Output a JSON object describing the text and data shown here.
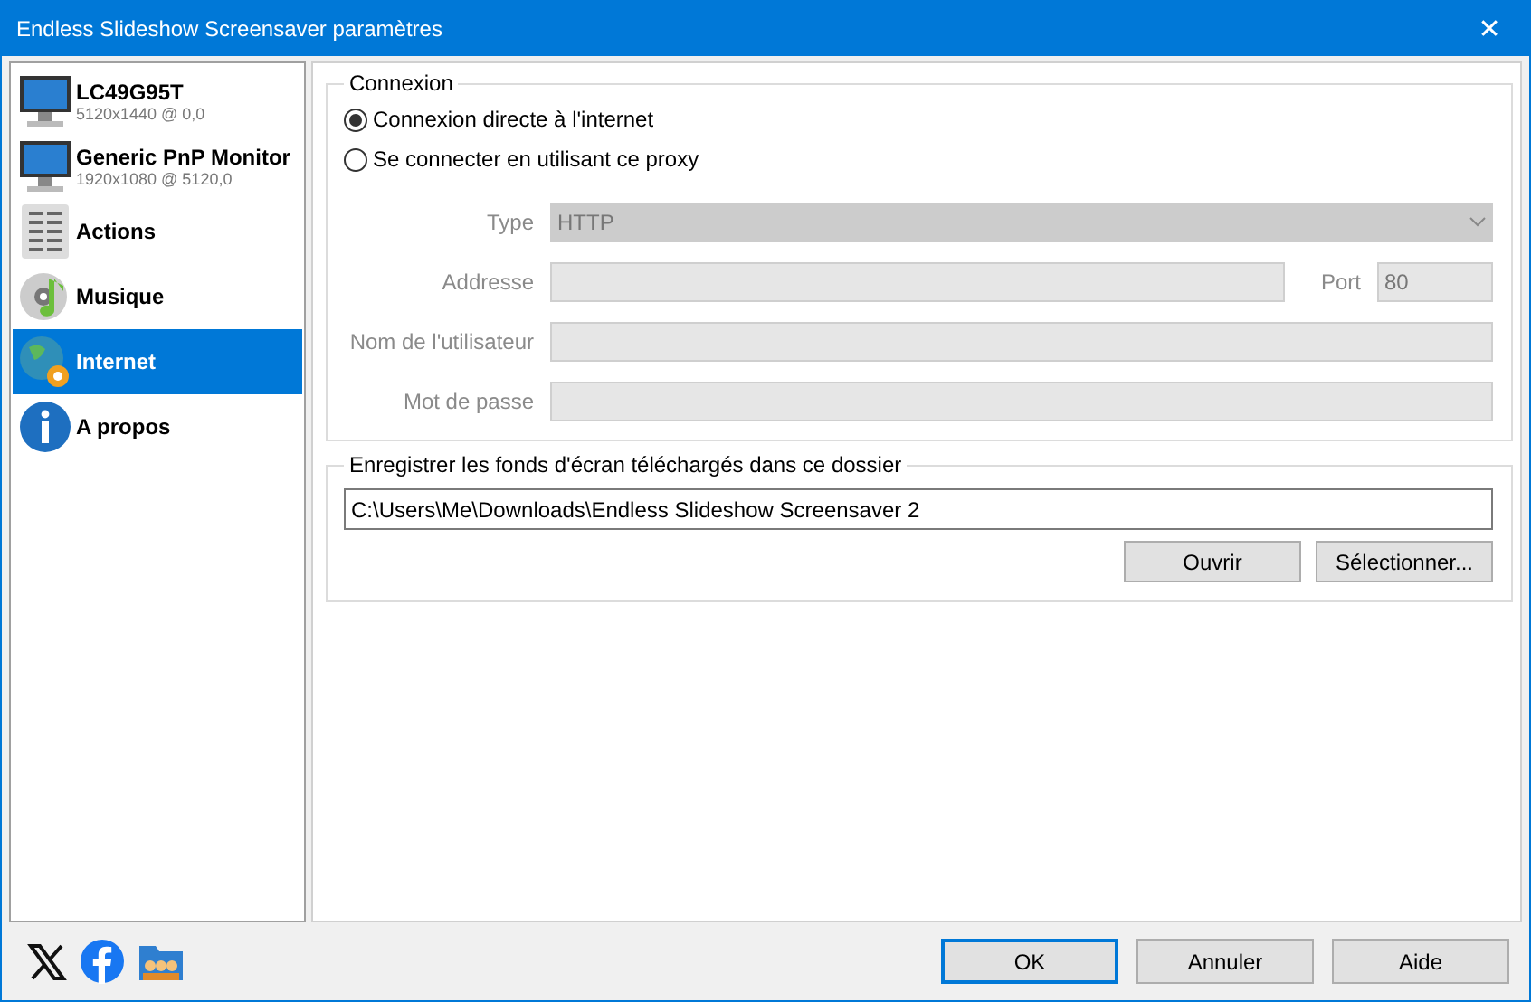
{
  "window": {
    "title": "Endless Slideshow Screensaver paramètres",
    "close": "✕"
  },
  "sidebar": {
    "items": [
      {
        "kind": "monitor",
        "label": "LC49G95T",
        "detail": "5120x1440 @ 0,0",
        "selected": false
      },
      {
        "kind": "monitor",
        "label": "Generic PnP Monitor",
        "detail": "1920x1080 @ 5120,0",
        "selected": false
      },
      {
        "kind": "actions",
        "label": "Actions",
        "selected": false
      },
      {
        "kind": "music",
        "label": "Musique",
        "selected": false
      },
      {
        "kind": "internet",
        "label": "Internet",
        "selected": true
      },
      {
        "kind": "about",
        "label": "A propos",
        "selected": false
      }
    ]
  },
  "connection": {
    "legend": "Connexion",
    "options": [
      {
        "label": "Connexion directe à l'internet",
        "selected": true
      },
      {
        "label": "Se connecter en utilisant ce proxy",
        "selected": false
      }
    ],
    "type": {
      "label": "Type",
      "value": "HTTP",
      "disabled": true
    },
    "address": {
      "label": "Addresse",
      "disabled": true
    },
    "port": {
      "label": "Port",
      "value": "80",
      "disabled": true
    },
    "user": {
      "label": "Nom de l'utilisateur",
      "disabled": true
    },
    "password": {
      "label": "Mot de passe",
      "disabled": true
    }
  },
  "download": {
    "legend": "Enregistrer les fonds d'écran téléchargés dans ce dossier",
    "path": "C:\\Users\\Me\\Downloads\\Endless Slideshow Screensaver 2",
    "buttons": [
      "Ouvrir",
      "Sélectionner..."
    ]
  },
  "footer": {
    "buttons": [
      {
        "label": "OK",
        "default": true
      },
      {
        "label": "Annuler",
        "default": false
      },
      {
        "label": "Aide",
        "default": false
      }
    ]
  }
}
